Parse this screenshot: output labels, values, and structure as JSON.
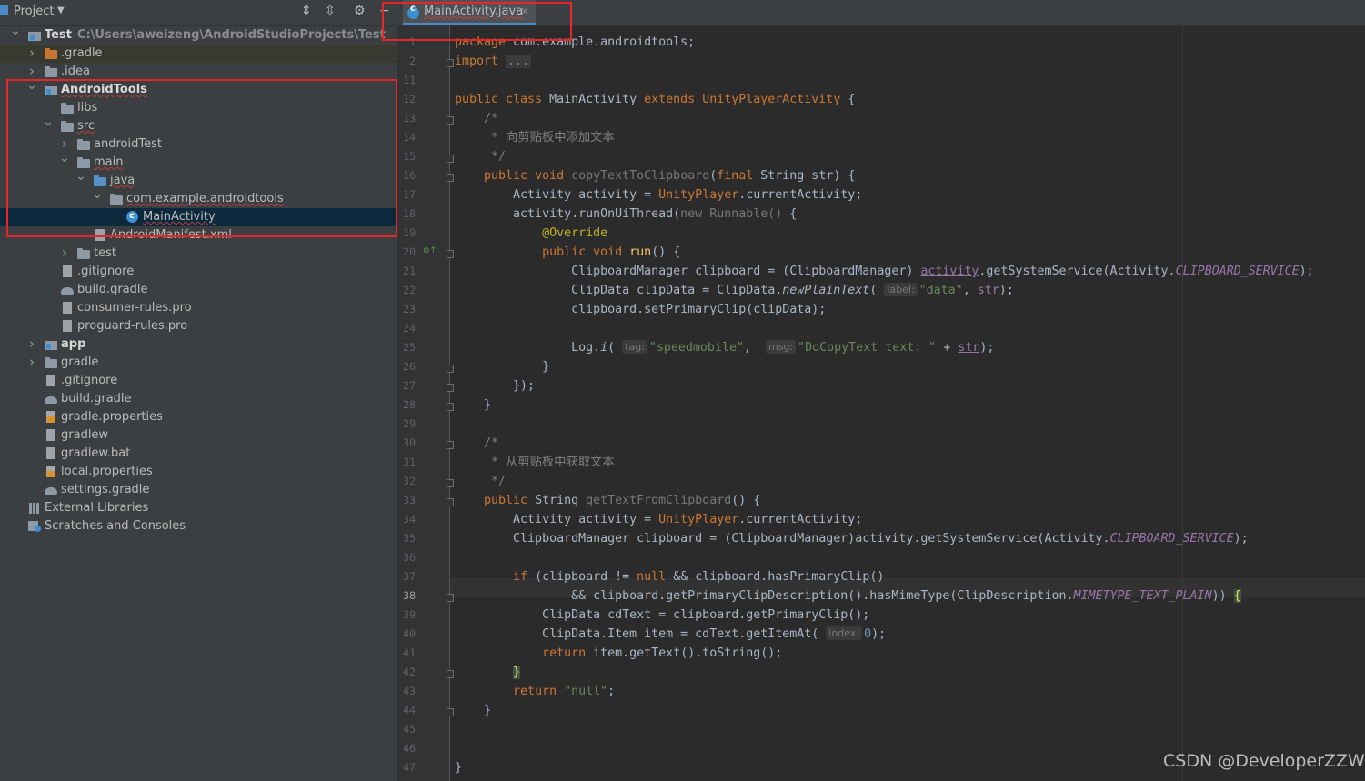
{
  "panel": {
    "title": "Project",
    "tools": [
      "expand-all-icon",
      "collapse-all-icon",
      "gear-icon",
      "minimize-icon"
    ]
  },
  "tree": [
    {
      "label": "Test",
      "path": "C:\\Users\\aweizeng\\AndroidStudioProjects\\Test",
      "icon": "module",
      "arrow": "v",
      "bold": true
    },
    {
      "label": ".gradle",
      "icon": "folder-orange",
      "arrow": ">",
      "highlight": true
    },
    {
      "label": ".idea",
      "icon": "folder",
      "arrow": ">"
    },
    {
      "label": "AndroidTools",
      "icon": "module",
      "arrow": "v",
      "bold": true,
      "squiggle": true
    },
    {
      "label": "libs",
      "icon": "folder"
    },
    {
      "label": "src",
      "icon": "folder",
      "arrow": "v",
      "squiggle": true
    },
    {
      "label": "androidTest",
      "icon": "folder",
      "arrow": ">"
    },
    {
      "label": "main",
      "icon": "folder",
      "arrow": "v",
      "squiggle": true
    },
    {
      "label": "java",
      "icon": "folder-blue",
      "arrow": "v",
      "squiggle": true
    },
    {
      "label": "com.example.androidtools",
      "icon": "folder",
      "arrow": "v",
      "squiggle": true
    },
    {
      "label": "MainActivity",
      "icon": "class",
      "selected": true,
      "squiggle": true
    },
    {
      "label": "AndroidManifest.xml",
      "icon": "file"
    },
    {
      "label": "test",
      "icon": "folder",
      "arrow": ">"
    },
    {
      "label": ".gitignore",
      "icon": "file"
    },
    {
      "label": "build.gradle",
      "icon": "gradle"
    },
    {
      "label": "consumer-rules.pro",
      "icon": "file"
    },
    {
      "label": "proguard-rules.pro",
      "icon": "file"
    },
    {
      "label": "app",
      "icon": "module",
      "arrow": ">",
      "bold": true
    },
    {
      "label": "gradle",
      "icon": "folder",
      "arrow": ">"
    },
    {
      "label": ".gitignore",
      "icon": "file"
    },
    {
      "label": "build.gradle",
      "icon": "gradle"
    },
    {
      "label": "gradle.properties",
      "icon": "props"
    },
    {
      "label": "gradlew",
      "icon": "file"
    },
    {
      "label": "gradlew.bat",
      "icon": "file"
    },
    {
      "label": "local.properties",
      "icon": "props"
    },
    {
      "label": "settings.gradle",
      "icon": "gradle"
    },
    {
      "label": "External Libraries",
      "icon": "lib"
    },
    {
      "label": "Scratches and Consoles",
      "icon": "scratch"
    }
  ],
  "editor": {
    "tab": {
      "label": "MainActivity.java",
      "close": "×"
    },
    "current_line": 38,
    "lines": [
      {
        "n": 1,
        "code": "<span class='kw'>package</span> com.example.androidtools;"
      },
      {
        "n": 2,
        "code": "<span class='kw'>import</span> <span class='fold-box'>...</span>"
      },
      {
        "n": 11,
        "code": ""
      },
      {
        "n": 12,
        "code": "<span class='kw'>public class</span> MainActivity <span class='kw'>extends</span> <span class='fqn'>UnityPlayerActivity</span> {"
      },
      {
        "n": 13,
        "code": "    <span class='cmt'>/*</span>"
      },
      {
        "n": 14,
        "code": "<span class='cmt'>     * 向剪贴板中添加文本</span>"
      },
      {
        "n": 15,
        "code": "<span class='cmt'>     */</span>"
      },
      {
        "n": 16,
        "code": "    <span class='kw'>public void</span> <span class='dim'>copyTextToClipboard</span>(<span class='kw'>final</span> String str) {"
      },
      {
        "n": 17,
        "code": "        Activity activity = <span class='fqn'>UnityPlayer</span>.currentActivity;"
      },
      {
        "n": 18,
        "code": "        activity.runOnUiThread(<span class='dim'>new</span> <span class='dim'>Runnable()</span> {"
      },
      {
        "n": 19,
        "code": "            <span class='ann'>@Override</span>"
      },
      {
        "n": 20,
        "code": "            <span class='kw'>public void</span> <span class='mdecl'>run</span>() {"
      },
      {
        "n": 21,
        "code": "                ClipboardManager clipboard = (ClipboardManager) <span class='stat und' style='font-style:normal'>activity</span>.getSystemService(Activity.<span class='stat'>CLIPBOARD_SERVICE</span>);"
      },
      {
        "n": 22,
        "code": "                ClipData clipData = ClipData.<span class='ital'>newPlainText</span>( <span class='hint'>label:</span><span class='str'>\"data\"</span>, <span class='stat und' style='font-style:normal'>str</span>);"
      },
      {
        "n": 23,
        "code": "                clipboard.setPrimaryClip(clipData);"
      },
      {
        "n": 24,
        "code": ""
      },
      {
        "n": 25,
        "code": "                Log.<span class='ital'>i</span>( <span class='hint'>tag:</span><span class='str'>\"speedmobile\"</span>,  <span class='hint'>msg:</span><span class='str'>\"DoCopyText text: \"</span> + <span class='stat und' style='font-style:normal'>str</span>);"
      },
      {
        "n": 26,
        "code": "            }"
      },
      {
        "n": 27,
        "code": "        });"
      },
      {
        "n": 28,
        "code": "    }"
      },
      {
        "n": 29,
        "code": ""
      },
      {
        "n": 30,
        "code": "    <span class='cmt'>/*</span>"
      },
      {
        "n": 31,
        "code": "<span class='cmt'>     * 从剪贴板中获取文本</span>"
      },
      {
        "n": 32,
        "code": "<span class='cmt'>     */</span>"
      },
      {
        "n": 33,
        "code": "    <span class='kw'>public</span> String <span class='dim'>getTextFromClipboard</span>() {"
      },
      {
        "n": 34,
        "code": "        Activity activity = <span class='fqn'>UnityPlayer</span>.currentActivity;"
      },
      {
        "n": 35,
        "code": "        ClipboardManager clipboard = (ClipboardManager)activity.getSystemService(Activity.<span class='stat'>CLIPBOARD_SERVICE</span>);"
      },
      {
        "n": 36,
        "code": ""
      },
      {
        "n": 37,
        "code": "        <span class='kw'>if</span> (clipboard != <span class='kw'>null</span> &amp;&amp; clipboard.hasPrimaryClip()"
      },
      {
        "n": 38,
        "code": "                &amp;&amp; clipboard.getPrimaryClipDescription().hasMimeType(ClipDescription.<span class='stat'>MIMETYPE_TEXT_PLAIN</span>)) <span class='brace-match'>{</span>"
      },
      {
        "n": 39,
        "code": "            ClipData cdText = clipboard.getPrimaryClip();"
      },
      {
        "n": 40,
        "code": "            ClipData.Item item = cdText.getItemAt( <span class='hint'>index:</span><span class='num'>0</span>);"
      },
      {
        "n": 41,
        "code": "            <span class='kw'>return</span> item.getText().toString();"
      },
      {
        "n": 42,
        "code": "        <span class='brace-match'>}</span>"
      },
      {
        "n": 43,
        "code": "        <span class='kw'>return</span> <span class='str'>\"null\"</span>;"
      },
      {
        "n": 44,
        "code": "    }"
      },
      {
        "n": 45,
        "code": ""
      },
      {
        "n": 46,
        "code": ""
      },
      {
        "n": 47,
        "code": "}"
      }
    ]
  },
  "watermark": "CSDN @DeveloperZZW",
  "colors": {
    "highlight_box": "#e8262a",
    "accent": "#4a88c7"
  }
}
